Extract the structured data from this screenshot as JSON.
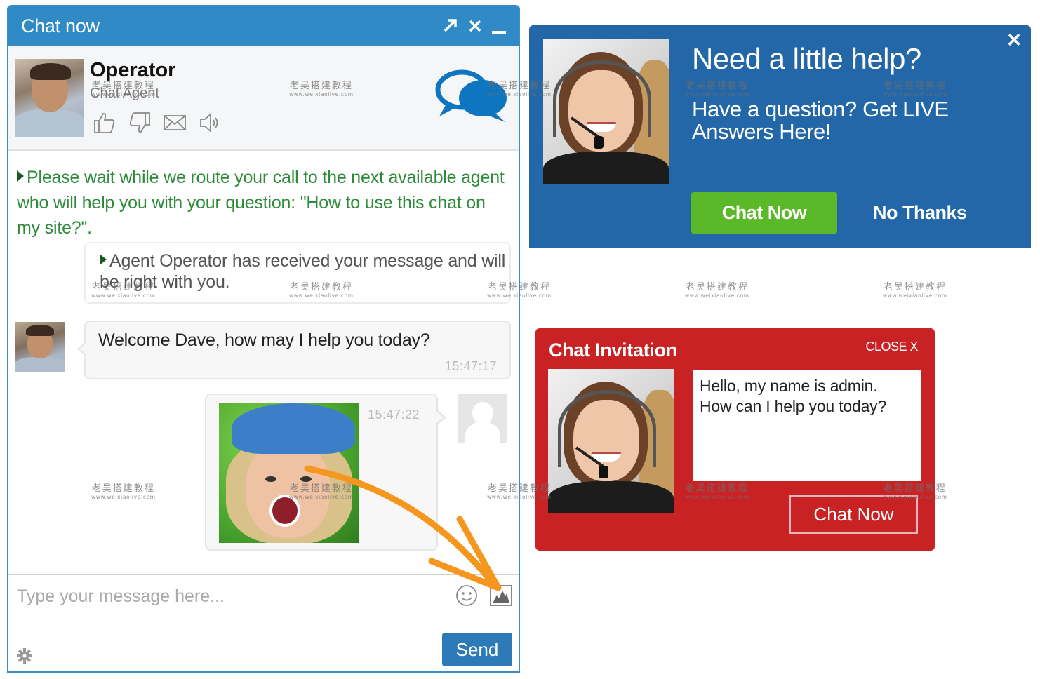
{
  "chat_window": {
    "title": "Chat now",
    "title_icons": [
      "popout-icon",
      "close-icon",
      "minimize-icon"
    ],
    "agent": {
      "name": "Operator",
      "role": "Chat Agent",
      "actions": [
        "thumbs-up-icon",
        "thumbs-down-icon",
        "email-icon",
        "sound-icon"
      ]
    },
    "messages": {
      "system": "Please wait while we route your call to the next available agent who will help you with your question: \"How to use this chat on my site?\".",
      "acknowledgement": "Agent Operator has received your message and will be right with you.",
      "agent_message": {
        "text": "Welcome Dave, how may I help you today?",
        "time": "15:47:17"
      },
      "user_message": {
        "type": "image",
        "time": "15:47:22"
      }
    },
    "composer": {
      "placeholder": "Type your message here...",
      "value": "",
      "send_label": "Send"
    }
  },
  "help_popup": {
    "title": "Need a little help?",
    "subtitle": "Have a question? Get LIVE Answers Here!",
    "primary_label": "Chat Now",
    "secondary_label": "No Thanks",
    "close_label": "×",
    "colors": {
      "background": "#2367a8",
      "button": "#5bb929"
    }
  },
  "invite_popup": {
    "title": "Chat Invitation",
    "close_label": "CLOSE X",
    "message_line1": "Hello, my name is admin.",
    "message_line2": "How can I help you today?",
    "button_label": "Chat Now",
    "colors": {
      "background": "#c92225"
    }
  },
  "colors": {
    "header_blue": "#2f8ac6",
    "system_green": "#2e8b3a",
    "send_blue": "#2d7ab8",
    "annotation_orange": "#f5961e"
  },
  "watermark": {
    "cn": "老吴搭建教程",
    "url": "www.weixiaolive.com"
  }
}
